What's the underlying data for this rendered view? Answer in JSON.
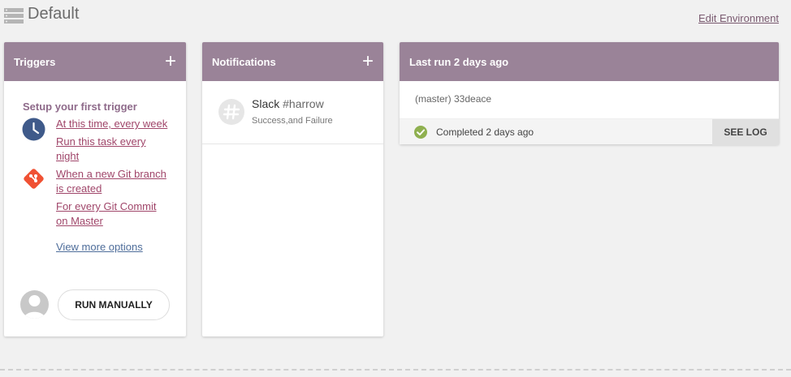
{
  "header": {
    "title": "Default",
    "edit_link": "Edit Environment"
  },
  "triggers": {
    "title": "Triggers",
    "add_label": "+",
    "heading": "Setup your first trigger",
    "links": [
      "At this time, every week",
      "Run this task every",
      "night",
      "When a new Git branch",
      "is created",
      "For every Git Commit",
      "on Master"
    ],
    "more_link": "View more options",
    "run_button": "RUN MANUALLY",
    "icons": [
      "clock-icon",
      "git-icon",
      "user-avatar-icon"
    ],
    "colors": {
      "clock": "#3f5a8a",
      "git": "#f05133"
    }
  },
  "notifications": {
    "title": "Notifications",
    "add_label": "+",
    "items": [
      {
        "service": "Slack",
        "channel": "#harrow",
        "events": "Success,and Failure"
      }
    ]
  },
  "last_run": {
    "title": "Last run 2 days ago",
    "commit": "(master) 33deace",
    "status": "Completed 2 days ago",
    "see_log": "SEE LOG",
    "status_color": "#8fb050"
  },
  "colors": {
    "header_bg": "#9a8398",
    "link": "#a0466a",
    "more_link": "#4e6d9a"
  }
}
